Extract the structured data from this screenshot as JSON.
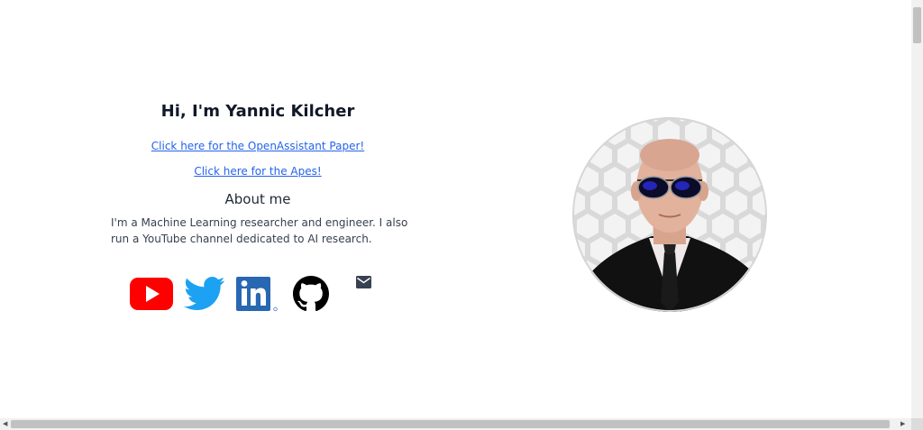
{
  "intro": {
    "title": "Hi, I'm Yannic Kilcher",
    "link_openassistant": "Click here for the OpenAssistant Paper!",
    "link_apes": "Click here for the Apes!"
  },
  "about": {
    "heading": "About me",
    "text": "I'm a Machine Learning researcher and engineer. I also run a YouTube channel dedicated to AI research."
  },
  "socials": [
    {
      "icon": "youtube-icon",
      "color": "#ff0000"
    },
    {
      "icon": "twitter-icon",
      "color": "#1da1f2"
    },
    {
      "icon": "linkedin-icon",
      "color": "#2867b2"
    },
    {
      "icon": "github-icon",
      "color": "#000000"
    },
    {
      "icon": "mail-icon",
      "color": "#374151"
    }
  ],
  "colors": {
    "link": "#2563eb",
    "heading": "#111827",
    "body_text": "#374151"
  }
}
